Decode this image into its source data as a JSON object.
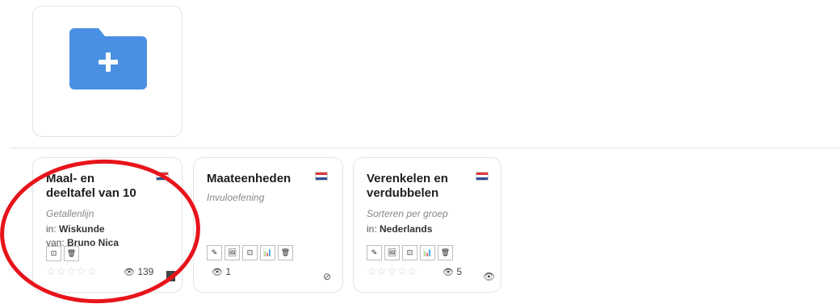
{
  "new_folder": {
    "icon": "folder-plus-icon",
    "color": "#4a90e2"
  },
  "cards": [
    {
      "title": "Maal- en deeltafel van 10",
      "subtitle": "Getallenlijn",
      "in_label": "in: ",
      "in_value": "Wiskunde",
      "by_label": "van: ",
      "by_value": "Bruno Nica",
      "views": "139",
      "stars": "☆☆☆☆☆"
    },
    {
      "title": "Maateenheden",
      "subtitle": "Invuloefening",
      "views": "1"
    },
    {
      "title": "Verenkelen en verdubbelen",
      "subtitle": "Sorteren per groep",
      "in_label": "in: ",
      "in_value": "Nederlands",
      "views": "5",
      "stars": "☆☆☆☆☆"
    }
  ],
  "icons": {
    "edit": "✎",
    "image": "🖼",
    "folder": "⊡",
    "stats": "📊",
    "trash": "🗑",
    "eye": "👁"
  },
  "colors": {
    "annotation": "#e8141b",
    "folder": "#4a90e2"
  }
}
